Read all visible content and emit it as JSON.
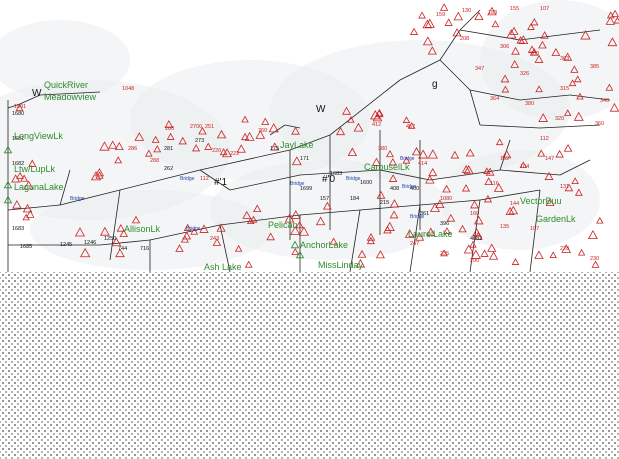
{
  "colors": {
    "background": "#ffffff",
    "haze": "#e9ecef",
    "line": "#222222",
    "node_triangle": "#cc2222",
    "lake_label": "#2e8b2e",
    "node_label": "#cc2222",
    "bridge_label": "#2244aa"
  },
  "lakes": [
    {
      "name": "QuickRiver"
    },
    {
      "name": "Meadowview"
    },
    {
      "name": "LongViewLk"
    },
    {
      "name": "Ltw/LupLk"
    },
    {
      "name": "LagunaLake"
    },
    {
      "name": "JayLake"
    },
    {
      "name": "CarouselLk"
    },
    {
      "name": "Pelican"
    },
    {
      "name": "AnchorLake"
    },
    {
      "name": "LaurelLake"
    },
    {
      "name": "MissLinday"
    },
    {
      "name": "AllisonLk"
    },
    {
      "name": "Ash Lake"
    },
    {
      "name": "VectorBuu"
    },
    {
      "name": "GardenLk"
    }
  ],
  "node_labels": {
    "red": [
      "1048",
      "1591",
      "280",
      "286",
      "2700",
      "251",
      "220",
      "222",
      "288",
      "112",
      "760",
      "412",
      "457",
      "380",
      "414",
      "1080",
      "159",
      "130",
      "183",
      "155",
      "107",
      "208",
      "306",
      "300",
      "363",
      "385",
      "347",
      "326",
      "315",
      "340",
      "364",
      "380",
      "320",
      "360",
      "112",
      "152",
      "104",
      "116",
      "147",
      "131",
      "144",
      "160",
      "135",
      "107",
      "228",
      "230",
      "247",
      "235",
      "290",
      "243"
    ],
    "black": [
      "1680",
      "1681",
      "1682",
      "1683",
      "1685",
      "1245",
      "1246",
      "1250",
      "744",
      "716",
      "281",
      "262",
      "273",
      "175",
      "171",
      "157",
      "184",
      "215",
      "408",
      "400",
      "361",
      "396",
      "4082",
      "1600",
      "1699",
      "1683"
    ],
    "blue": [
      "Bridge",
      "Bridge",
      "Bridge",
      "Bridge",
      "Bridge",
      "Bridge",
      "Bridge",
      "Bridge"
    ]
  },
  "glyphs": {
    "big": [
      "W",
      "W",
      "#'1",
      "#'0",
      "g"
    ]
  }
}
